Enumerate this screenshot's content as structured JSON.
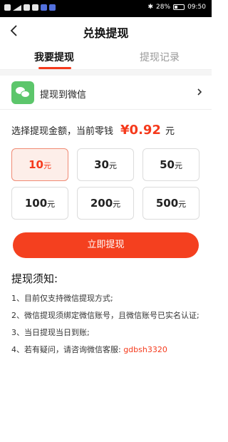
{
  "status_bar": {
    "battery": "28%",
    "time": "09:50"
  },
  "header": {
    "title": "兑换提现"
  },
  "tabs": [
    {
      "label": "我要提现"
    },
    {
      "label": "提现记录"
    }
  ],
  "method": {
    "label": "提现到微信"
  },
  "amount": {
    "prompt": "选择提现金额，当前零钱",
    "balance": "¥0.92",
    "unit": "元"
  },
  "options": [
    {
      "value": "10",
      "unit": "元"
    },
    {
      "value": "30",
      "unit": "元"
    },
    {
      "value": "50",
      "unit": "元"
    },
    {
      "value": "100",
      "unit": "元"
    },
    {
      "value": "200",
      "unit": "元"
    },
    {
      "value": "500",
      "unit": "元"
    }
  ],
  "submit_label": "立即提现",
  "notice": {
    "title": "提现须知:",
    "items": [
      "1、目前仅支持微信提现方式;",
      "2、微信提现须绑定微信账号，且微信账号已实名认证;",
      "3、当日提现当日到账;",
      "4、若有疑问，请咨询微信客服: "
    ],
    "service_id": "gdbsh3320"
  },
  "colors": {
    "accent": "#f53a1c",
    "wechat": "#5cc66b"
  }
}
